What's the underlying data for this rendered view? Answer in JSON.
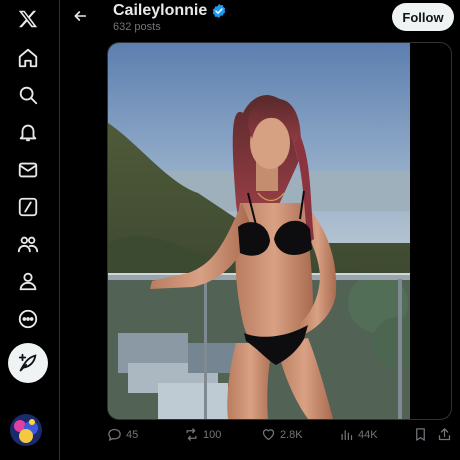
{
  "nav": {
    "items": [
      {
        "name": "x-logo-icon"
      },
      {
        "name": "home-icon"
      },
      {
        "name": "search-icon"
      },
      {
        "name": "bell-icon"
      },
      {
        "name": "mail-icon"
      },
      {
        "name": "grok-icon"
      },
      {
        "name": "communities-icon"
      },
      {
        "name": "profile-icon"
      },
      {
        "name": "more-icon"
      }
    ],
    "post_button_icon": "feather-plus-icon"
  },
  "header": {
    "title": "Caileylonnie",
    "subtitle": "632 posts",
    "follow_label": "Follow",
    "verified_color": "#1d9bf0"
  },
  "actions": {
    "replies": "45",
    "reposts": "100",
    "likes": "2.8K",
    "views": "44K"
  },
  "colors": {
    "accent": "#1d9bf0",
    "muted": "#71767b",
    "background": "#000000"
  }
}
